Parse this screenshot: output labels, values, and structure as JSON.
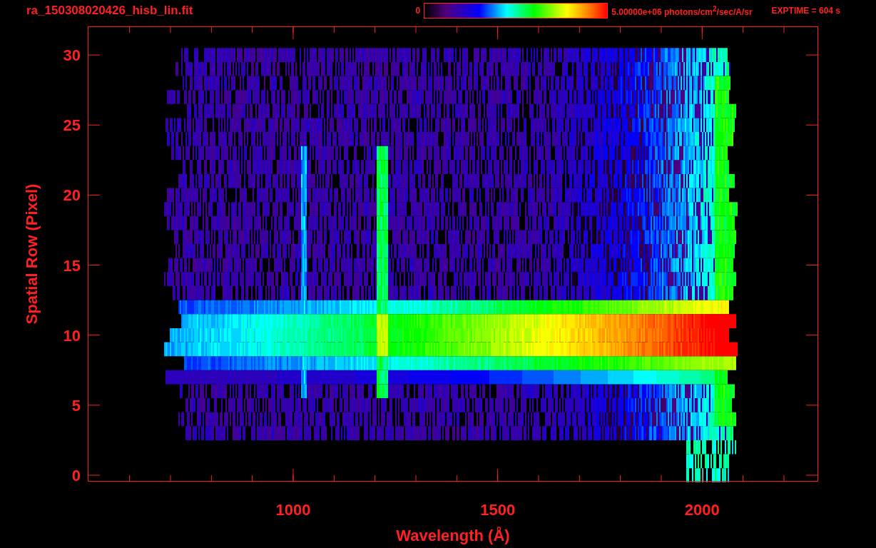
{
  "header": {
    "title": "ra_150308020426_hisb_lin.fit",
    "colorbar_min": "0",
    "colorbar_max": "5.00000e+06 photons/cm$^{2}$/sec/A/sr",
    "exposure": "EXPTIME = 604 s"
  },
  "plot": {
    "xlabel": "Wavelength (Å)",
    "ylabel": "Spatial Row (Pixel)",
    "xticks": [
      {
        "label": "1000"
      },
      {
        "label": "1500"
      },
      {
        "label": "2000"
      }
    ],
    "yticks": [
      {
        "label": "30"
      },
      {
        "label": "25"
      },
      {
        "label": "20"
      },
      {
        "label": "15"
      },
      {
        "label": "10"
      },
      {
        "label": "5"
      },
      {
        "label": "0"
      }
    ]
  }
}
